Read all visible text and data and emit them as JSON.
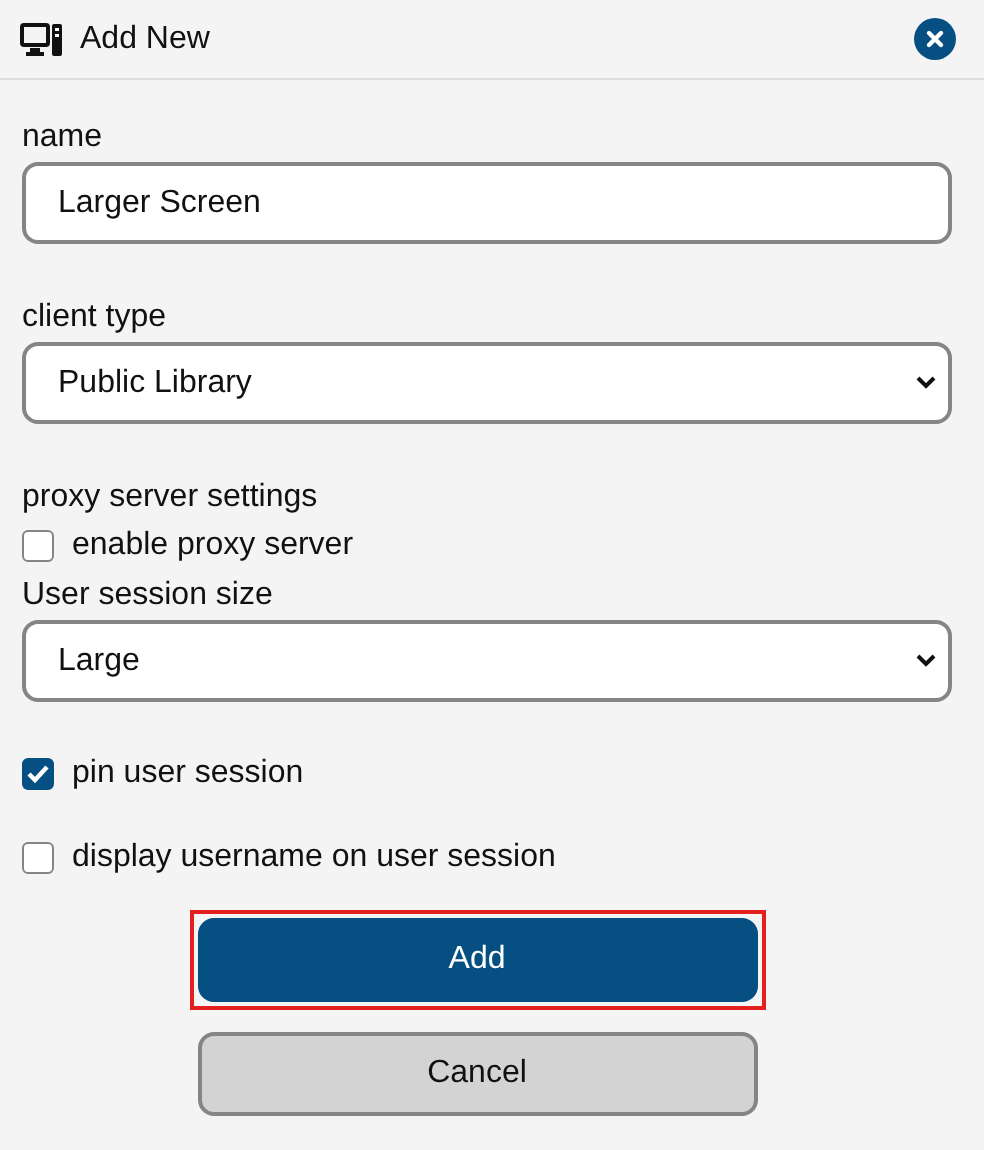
{
  "dialog": {
    "title": "Add New"
  },
  "fields": [
    {
      "kind": "text",
      "label": "name",
      "value": "Larger Screen"
    },
    {
      "kind": "select",
      "label": "client type",
      "value": "Public Library"
    },
    {
      "kind": "heading",
      "label": "proxy server settings"
    },
    {
      "kind": "checkbox",
      "label": "enable proxy server",
      "checked": false
    },
    {
      "kind": "select",
      "label": "User session size",
      "value": "Large"
    },
    {
      "kind": "checkbox",
      "label": "pin user session",
      "checked": true
    },
    {
      "kind": "checkbox",
      "label": "display username on user session",
      "checked": false
    }
  ],
  "buttons": [
    {
      "label": "Add",
      "kind": "primary",
      "focused": true
    },
    {
      "label": "Cancel",
      "kind": "secondary",
      "focused": false
    }
  ]
}
